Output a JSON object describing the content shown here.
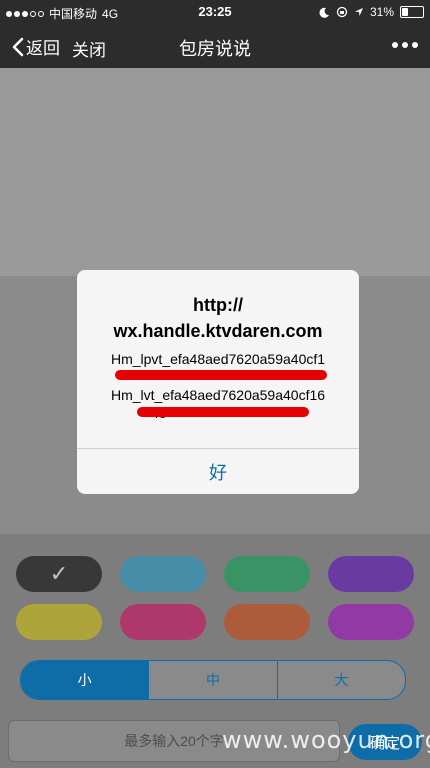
{
  "status_bar": {
    "carrier": "中国移动",
    "network": "4G",
    "time": "23:25",
    "battery": "31%",
    "battery_level": 0.31
  },
  "nav": {
    "back_label": "返回",
    "close_label": "关闭",
    "title": "包房说说"
  },
  "palette": {
    "colors": [
      "#000000",
      "#1a9bcb",
      "#03a550",
      "#5b04c3",
      "#d6c601",
      "#d8005c",
      "#d33f06",
      "#a204c6"
    ],
    "selected_index": 0
  },
  "size": {
    "options": [
      "小",
      "中",
      "大"
    ],
    "selected": "小"
  },
  "input": {
    "placeholder": "最多输入20个字",
    "value": ""
  },
  "confirm_label": "确定",
  "watermark": "www.wooyun.org",
  "dialog": {
    "title_line1": "http://",
    "title_line2": "wx.handle.ktvdaren.com",
    "message_line1": "Hm_lpvt_efa48aed7620a59a40cf1",
    "message_line2": "Hm_lvt_efa48aed7620a59a40cf16",
    "message_line3": "48",
    "ok_label": "好"
  }
}
